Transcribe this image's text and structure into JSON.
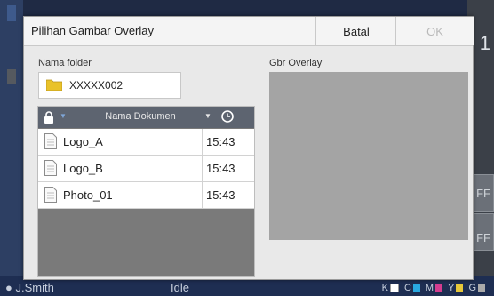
{
  "background": {
    "user": "J.Smith",
    "status": "Idle",
    "right_labels": [
      "FF",
      "FF"
    ],
    "right_number": "1",
    "ink": [
      "K",
      "C",
      "M",
      "Y",
      "G"
    ],
    "colors": {
      "K": "#1a1a1a",
      "C": "#29a8e0",
      "M": "#d43c8f",
      "Y": "#e6c73a",
      "G": "#777777"
    }
  },
  "dialog": {
    "title": "Pilihan Gambar Overlay",
    "cancel_label": "Batal",
    "ok_label": "OK",
    "folder_label": "Nama folder",
    "folder_value": "XXXXX002",
    "preview_label": "Gbr Overlay",
    "list": {
      "column_name": "Nama Dokumen",
      "rows": [
        {
          "name": "Logo_A",
          "time": "15:43"
        },
        {
          "name": "Logo_B",
          "time": "15:43"
        },
        {
          "name": "Photo_01",
          "time": "15:43"
        }
      ]
    }
  }
}
